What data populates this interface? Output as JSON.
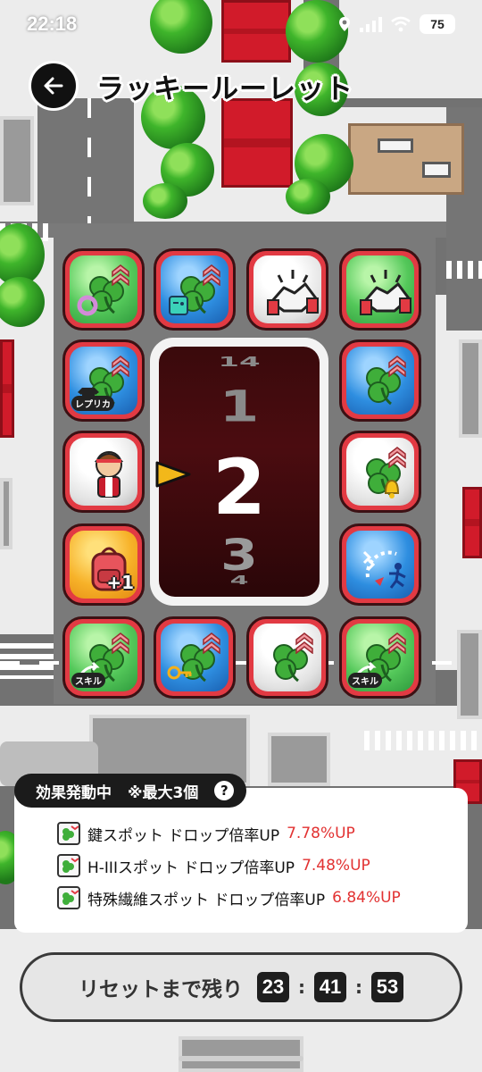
{
  "status_bar": {
    "time": "22:18",
    "battery": "75",
    "icons": [
      "location-icon",
      "signal-icon",
      "wifi-icon",
      "battery-icon"
    ]
  },
  "header": {
    "title": "ラッキールーレット",
    "back_icon": "arrow-left-icon"
  },
  "roulette": {
    "reel": {
      "top": "14",
      "prev": "1",
      "current": "2",
      "next": "3",
      "bottom": "4"
    },
    "tiles": [
      {
        "id": "t1",
        "color": "green",
        "icon": "clover-ring-icon",
        "badge": ""
      },
      {
        "id": "t2",
        "color": "blue",
        "icon": "clover-game-icon",
        "badge": ""
      },
      {
        "id": "t3",
        "color": "white",
        "icon": "handshake-icon",
        "badge": ""
      },
      {
        "id": "t4",
        "color": "green",
        "icon": "handshake-icon",
        "badge": ""
      },
      {
        "id": "t5",
        "color": "blue",
        "icon": "clover-shirt-icon",
        "badge": "レプリカ"
      },
      {
        "id": "t6",
        "color": "blue",
        "icon": "clover-icon",
        "badge": ""
      },
      {
        "id": "t7",
        "color": "white",
        "icon": "player-character-icon",
        "badge": ""
      },
      {
        "id": "t8",
        "color": "white",
        "icon": "clover-bell-icon",
        "badge": ""
      },
      {
        "id": "t9",
        "color": "orange",
        "icon": "backpack-icon",
        "badge": "+1"
      },
      {
        "id": "t10",
        "color": "blue",
        "icon": "running-man-icon",
        "badge": ""
      },
      {
        "id": "t11",
        "color": "green",
        "icon": "clover-skill-icon",
        "badge": "スキル"
      },
      {
        "id": "t12",
        "color": "blue",
        "icon": "clover-key-icon",
        "badge": ""
      },
      {
        "id": "t13",
        "color": "white",
        "icon": "clover-icon",
        "badge": ""
      },
      {
        "id": "t14",
        "color": "green",
        "icon": "clover-skill-icon",
        "badge": "スキル"
      }
    ]
  },
  "effects_panel": {
    "tab_title": "効果発動中",
    "tab_note": "※最大3個",
    "help": "?",
    "items": [
      {
        "name": "鍵スポット ドロップ倍率UP",
        "value": "7.78%UP"
      },
      {
        "name": "H-IIIスポット ドロップ倍率UP",
        "value": "7.48%UP"
      },
      {
        "name": "特殊繊維スポット ドロップ倍率UP",
        "value": "6.84%UP"
      }
    ]
  },
  "reset": {
    "label": "リセットまで残り",
    "hours": "23",
    "minutes": "41",
    "seconds": "53",
    "separator": ":"
  },
  "colors": {
    "tile_border": "#e23a43",
    "accent_red": "#e23232",
    "roof_red": "#d11b2a",
    "reel_bg": "#3a0a0c",
    "pointer": "#f2b81a"
  }
}
